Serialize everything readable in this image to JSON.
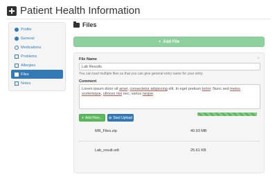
{
  "header": {
    "title": "Patient Health Information"
  },
  "sidebar": {
    "items": [
      {
        "label": "Profile",
        "icon": "user-icon",
        "active": false
      },
      {
        "label": "General",
        "icon": "info-icon",
        "active": false
      },
      {
        "label": "Medications",
        "icon": "medication-icon",
        "active": false
      },
      {
        "label": "Problems",
        "icon": "problem-icon",
        "active": false
      },
      {
        "label": "Allergies",
        "icon": "allergy-icon",
        "active": false
      },
      {
        "label": "Files",
        "icon": "file-icon",
        "active": true
      },
      {
        "label": "Notes",
        "icon": "notes-icon",
        "active": false
      }
    ]
  },
  "main": {
    "title": "Files",
    "add_file_label": "Add File",
    "close_glyph": "×",
    "form": {
      "file_name_label": "File Name",
      "file_name_value": "Lab Results",
      "help_text": "You can load multiple files so that you can give general entry name for your entry",
      "comment_label": "Comment",
      "comment_parts": {
        "p1": "Lorem ipsum dolor sit ",
        "p2": "amet",
        "p3": ", ",
        "p4": "consectetur adipiscing",
        "p5": " elit. In eget pretium ",
        "p6": "tortor",
        "p7": ". Nunc sed ",
        "p8": "metus scelerisque",
        "p9": ", ",
        "p10": "ultrices nisi",
        "p11": " nec, varius ",
        "p12": "neque",
        "p13": "."
      }
    },
    "buttons": {
      "add_files": "Add Files...",
      "start_upload": "Start Upload"
    },
    "files": [
      {
        "name": "MR_Files.zip",
        "size": "40.93 MB"
      },
      {
        "name": "Lab_result.odt",
        "size": "25.61 KB"
      }
    ],
    "upload_progress": 1.0
  },
  "colors": {
    "primary": "#337ab7",
    "success": "#5cb85c",
    "success_light": "#8fd19e"
  }
}
